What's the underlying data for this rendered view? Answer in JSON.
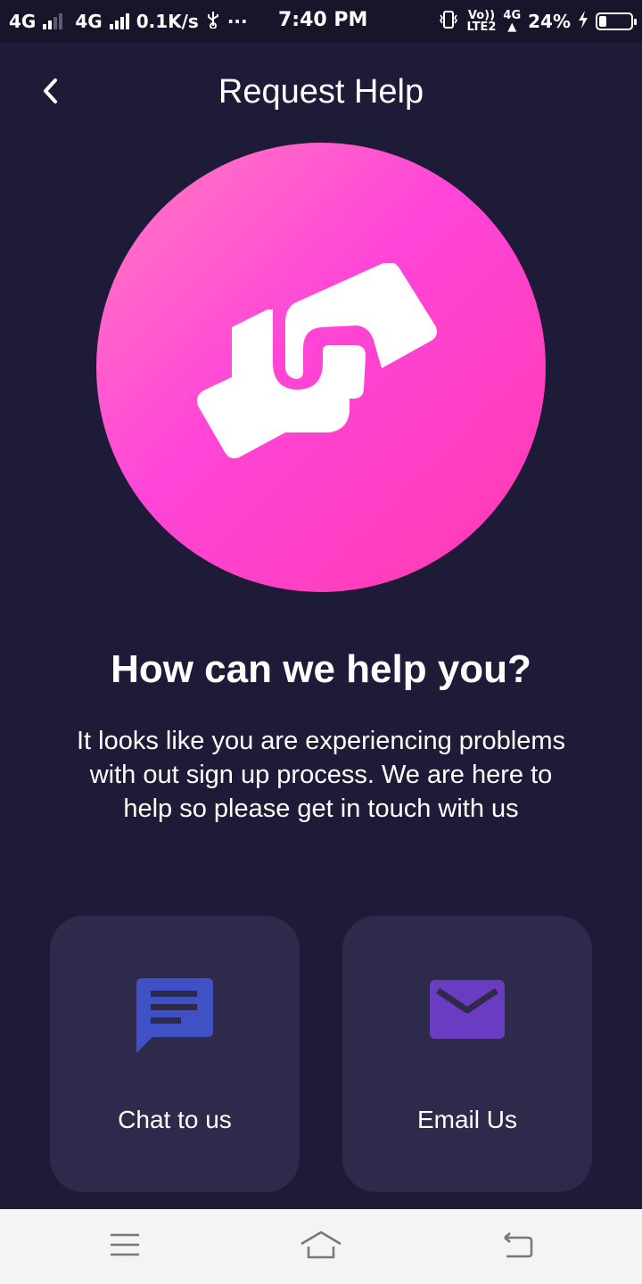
{
  "status_bar": {
    "network1": "4G",
    "network2": "4G",
    "speed": "0.1K/s",
    "usb_icon": "usb-icon",
    "more": "···",
    "time": "7:40 PM",
    "volte": "Vo))",
    "lte2": "LTE2",
    "network3": "4G",
    "battery_percent": "24%",
    "battery_level": 0.24
  },
  "header": {
    "title": "Request Help",
    "back_icon": "chevron-left-icon"
  },
  "hero": {
    "icon": "handshake-card-icon",
    "gradient_start": "#ff7cc0",
    "gradient_end": "#ff3ab0"
  },
  "main": {
    "heading": "How can we help you?",
    "body": "It looks like you are experiencing problems with out sign up process. We are here to help so please get in touch with us"
  },
  "options": [
    {
      "label": "Chat to us",
      "icon": "chat-bubble-icon",
      "icon_color": "#3f51c4"
    },
    {
      "label": "Email Us",
      "icon": "envelope-icon",
      "icon_color": "#6a3cc1"
    }
  ],
  "nav_bar": {
    "menu_icon": "menu-icon",
    "home_icon": "home-icon",
    "back_icon": "back-arrow-icon"
  },
  "colors": {
    "background": "#1e1b38",
    "status_bar": "#17152a",
    "card": "#2d2a4b",
    "nav_bar": "#f4f4f4"
  }
}
